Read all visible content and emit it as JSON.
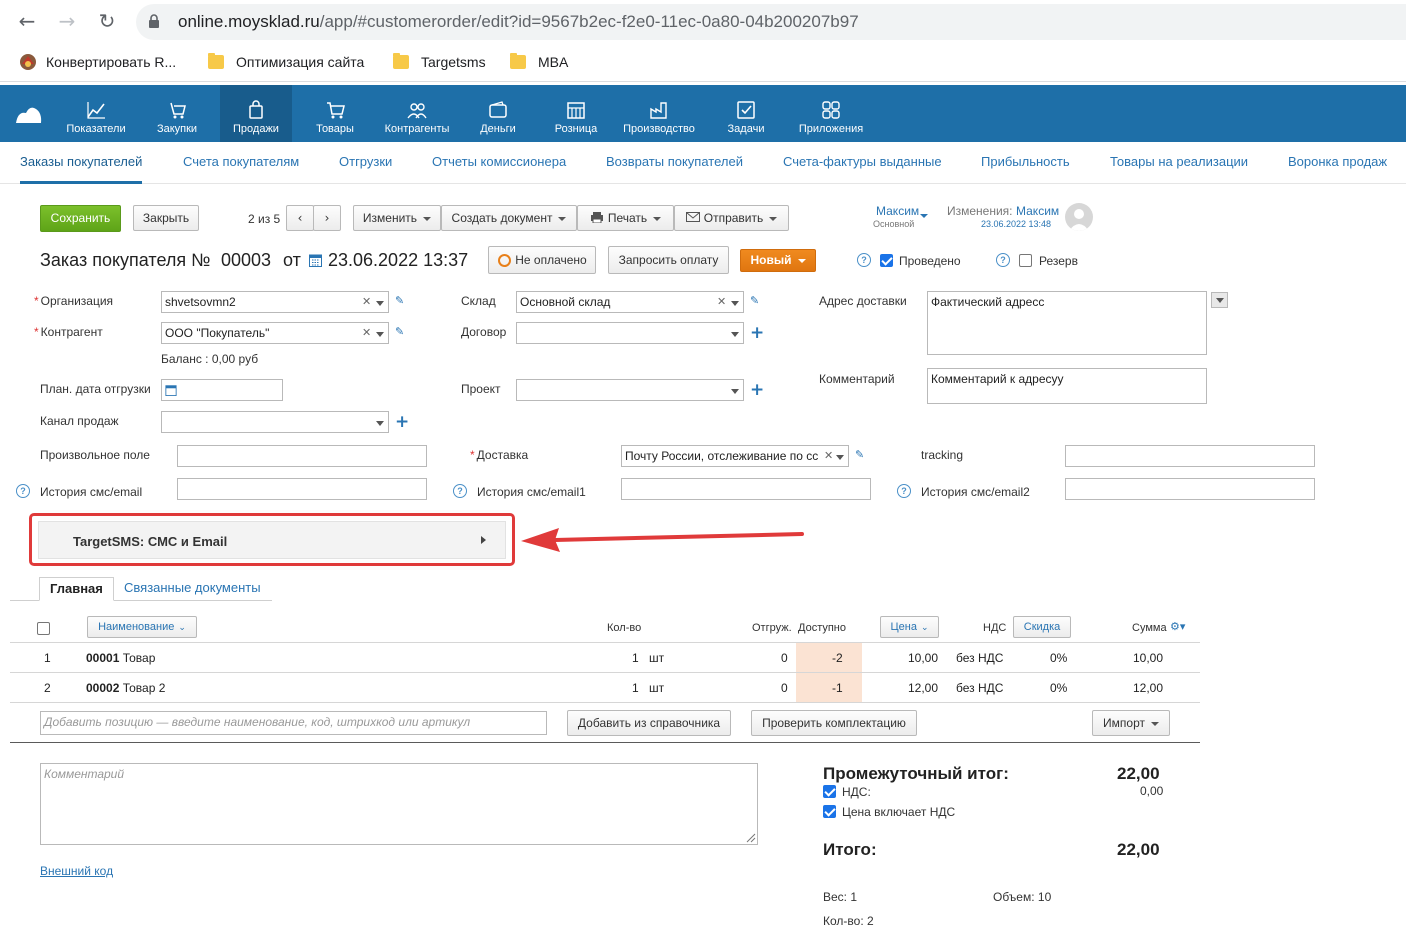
{
  "browser": {
    "url_host": "online.moysklad.ru",
    "url_path": "/app/#customerorder/edit?id=9567b2ec-f2e0-11ec-0a80-04b200207b97",
    "bookmarks": [
      "Конвертировать R...",
      "Оптимизация сайта",
      "Targetsms",
      "MBA"
    ]
  },
  "topnav": [
    "Показатели",
    "Закупки",
    "Продажи",
    "Товары",
    "Контрагенты",
    "Деньги",
    "Розница",
    "Производство",
    "Задачи",
    "Приложения"
  ],
  "subnav": [
    "Заказы покупателей",
    "Счета покупателям",
    "Отгрузки",
    "Отчеты комиссионера",
    "Возвраты покупателей",
    "Счета-фактуры выданные",
    "Прибыльность",
    "Товары на реализации",
    "Воронка продаж"
  ],
  "toolbar": {
    "save": "Сохранить",
    "close": "Закрыть",
    "pager": "2 из 5",
    "edit": "Изменить",
    "create_doc": "Создать документ",
    "print": "Печать",
    "send": "Отправить"
  },
  "owner": {
    "name": "Максим",
    "role": "Основной",
    "changes_label": "Изменения:",
    "changes_user": "Максим",
    "changes_time": "23.06.2022 13:48"
  },
  "doc": {
    "title": "Заказ покупателя №",
    "number": "00003",
    "from": "от",
    "date": "23.06.2022 13:37",
    "unpaid": "Не оплачено",
    "request_payment": "Запросить оплату",
    "status": "Новый",
    "posted": "Проведено",
    "reserve": "Резерв"
  },
  "form": {
    "org_label": "Организация",
    "org_value": "shvetsovmn2",
    "counterparty_label": "Контрагент",
    "counterparty_value": "ООО \"Покупатель\"",
    "balance": "Баланс : 0,00 руб",
    "ship_date_label": "План. дата отгрузки",
    "channel_label": "Канал продаж",
    "warehouse_label": "Склад",
    "warehouse_value": "Основной склад",
    "contract_label": "Договор",
    "project_label": "Проект",
    "delivery_address_label": "Адрес доставки",
    "delivery_address_value": "Фактический адресс",
    "comment_label": "Комментарий",
    "comment_value": "Комментарий к адресуу",
    "custom_label": "Произвольное поле",
    "delivery_label": "Доставка",
    "delivery_value": "Почту России, отслеживание по сс",
    "tracking_label": "tracking",
    "history1_label": "История смс/email",
    "history2_label": "История смс/email1",
    "history3_label": "История смс/email2"
  },
  "targetsms": {
    "label": "TargetSMS: СМС и Email"
  },
  "tabs": [
    "Главная",
    "Связанные документы"
  ],
  "table": {
    "headers": {
      "name": "Наименование",
      "qty": "Кол-во",
      "shipped": "Отгруж.",
      "available": "Доступно",
      "price": "Цена",
      "vat": "НДС",
      "discount": "Скидка",
      "sum": "Сумма"
    },
    "rows": [
      {
        "n": "1",
        "code": "00001",
        "name": "Товар",
        "qty": "1",
        "unit": "шт",
        "shipped": "0",
        "available": "-2",
        "price": "10,00",
        "vat": "без НДС",
        "discount": "0%",
        "sum": "10,00"
      },
      {
        "n": "2",
        "code": "00002",
        "name": "Товар 2",
        "qty": "1",
        "unit": "шт",
        "shipped": "0",
        "available": "-1",
        "price": "12,00",
        "vat": "без НДС",
        "discount": "0%",
        "sum": "12,00"
      }
    ],
    "add_placeholder": "Добавить позицию — введите наименование, код, штрихкод или артикул",
    "add_from_catalog": "Добавить из справочника",
    "check_kit": "Проверить комплектацию",
    "import": "Импорт"
  },
  "bottom": {
    "comment_placeholder": "Комментарий",
    "external_code": "Внешний код",
    "subtotal_label": "Промежуточный итог:",
    "subtotal_value": "22,00",
    "vat_label": "НДС:",
    "vat_value": "0,00",
    "price_incl_vat": "Цена включает НДС",
    "total_label": "Итого:",
    "total_value": "22,00",
    "weight": "Вес: 1",
    "volume": "Объем: 10",
    "count": "Кол-во: 2"
  },
  "colors": {
    "brand": "#1e6fa8",
    "save": "#6cb022",
    "status": "#e8801a",
    "annotation": "#e03a3a"
  }
}
